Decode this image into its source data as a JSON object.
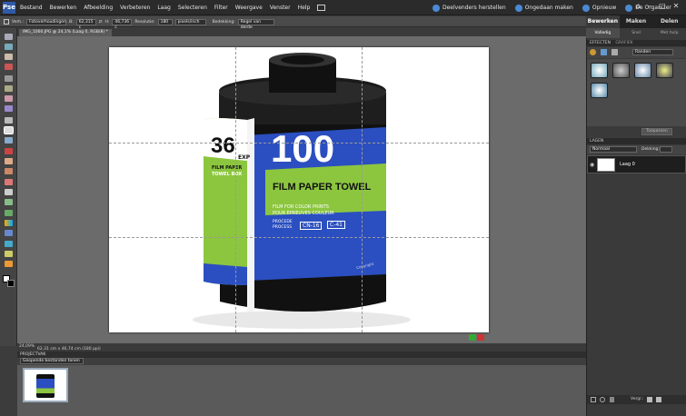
{
  "menubar": {
    "logo": "Pse",
    "menus": [
      "Bestand",
      "Bewerken",
      "Afbeelding",
      "Verbeteren",
      "Laag",
      "Selecteren",
      "Filter",
      "Weergave",
      "Venster",
      "Help"
    ],
    "undo": "Deelvenders herstellen",
    "redo": "Ongedaan maken",
    "redo2": "Opnieuw",
    "organizer": "De Organizer"
  },
  "options": {
    "tool": "Verh.:",
    "ratio": "Fotoverhoudingen",
    "w_label": "B:",
    "w": "62,315 c",
    "h_label": "H:",
    "h": "46,736 c",
    "res_label": "Resolutie:",
    "res": "180",
    "res_unit": "pixels/inch",
    "overlay_label": "Bedekking:",
    "overlay": "Regel van derde"
  },
  "doc": {
    "tab": "IMG_1060.JPG @ 24,1% (Laag 0, RGB/8) *",
    "zoom": "24,09%",
    "size": "62,31 cm x 46,74 cm (180 ppi)"
  },
  "photo": {
    "exp_num": "36",
    "exp": "EXP",
    "brand1": "FILM PAPER",
    "brand2": "TOWEL BOX",
    "iso": "100",
    "headline": "FILM PAPER TOWEL",
    "line1": "FILM FOR COLOR PRINTS",
    "line2": "POUR EPREUVES COULEUR",
    "process_label": "PROCESS",
    "process_label2": "PROCEDE",
    "process1": "CN-16",
    "process2": "C-41",
    "side": "Copyright"
  },
  "bin": {
    "title": "PROJECTVAK",
    "dropdown": "Geopende bestanden tonen"
  },
  "panel": {
    "tabs": [
      "Bewerken",
      "Maken",
      "Delen"
    ],
    "subtabs": [
      "Volledig",
      "Snel",
      "Met hulp"
    ],
    "effects_head": "EFFECTEN",
    "effects_sub": "GRAFIEK",
    "effects_dropdown": "Randen",
    "apply": "Toepassen",
    "layers_head": "LAGEN",
    "blend": "Normaal",
    "opacity_label": "Dekking:",
    "layer_name": "Laag 0",
    "lock_label": "Vergr.:"
  },
  "colors": {
    "accent": "#4a8ad4",
    "green": "#8cc63f",
    "blue": "#2b4fc0"
  }
}
